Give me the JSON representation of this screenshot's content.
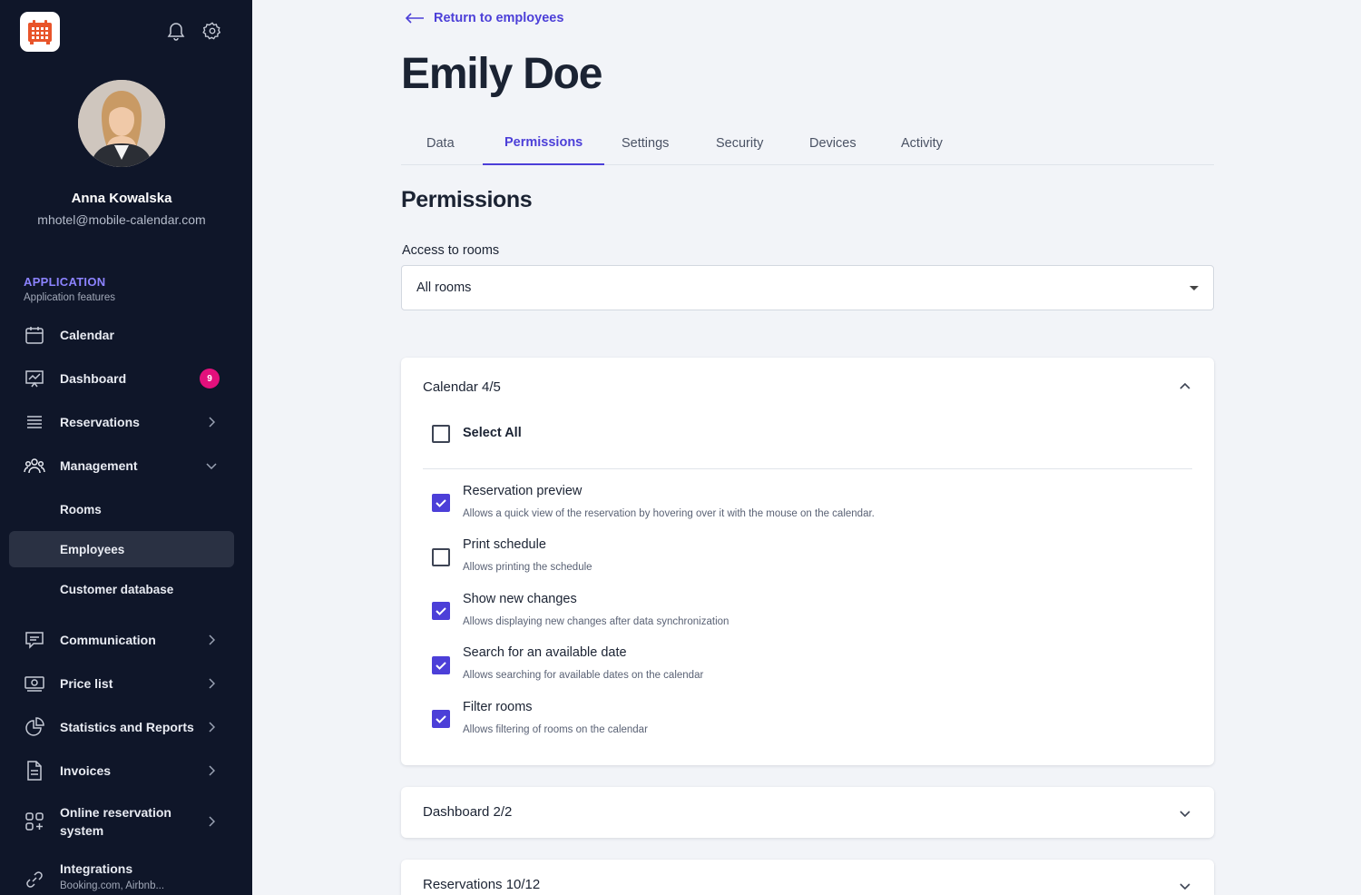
{
  "sidebar": {
    "user": {
      "name": "Anna Kowalska",
      "email": "mhotel@mobile-calendar.com"
    },
    "section": {
      "title": "APPLICATION",
      "subtitle": "Application features"
    },
    "items": [
      {
        "label": "Calendar",
        "icon": "calendar-icon"
      },
      {
        "label": "Dashboard",
        "icon": "chart-presentation-icon",
        "badge": "9"
      },
      {
        "label": "Reservations",
        "icon": "list-icon"
      },
      {
        "label": "Management",
        "icon": "users-icon"
      },
      {
        "label": "Rooms"
      },
      {
        "label": "Employees"
      },
      {
        "label": "Customer database"
      },
      {
        "label": "Communication",
        "icon": "message-icon"
      },
      {
        "label": "Price list",
        "icon": "money-icon"
      },
      {
        "label": "Statistics and Reports",
        "icon": "pie-chart-icon"
      },
      {
        "label": "Invoices",
        "icon": "document-icon"
      },
      {
        "label": "Online reservation",
        "label2": "system",
        "icon": "apps-icon"
      },
      {
        "label": "Integrations",
        "sub": "Booking.com, Airbnb...",
        "icon": "link-icon"
      }
    ]
  },
  "main": {
    "back_link": "Return to employees",
    "title": "Emily Doe",
    "tabs": [
      "Data",
      "Permissions",
      "Settings",
      "Security",
      "Devices",
      "Activity"
    ],
    "active_tab": "Permissions",
    "section_heading": "Permissions",
    "access": {
      "label": "Access to rooms",
      "value": "All rooms"
    },
    "calendar_group": {
      "title": "Calendar 4/5",
      "select_all": "Select All",
      "permissions": [
        {
          "title": "Reservation preview",
          "desc": "Allows a quick view of the reservation by hovering over it with the mouse on the calendar.",
          "checked": true
        },
        {
          "title": "Print schedule",
          "desc": "Allows printing the schedule",
          "checked": false
        },
        {
          "title": "Show new changes",
          "desc": "Allows displaying new changes after data synchronization",
          "checked": true
        },
        {
          "title": "Search for an available date",
          "desc": "Allows searching for available dates on the calendar",
          "checked": true
        },
        {
          "title": "Filter rooms",
          "desc": "Allows filtering of rooms on the calendar",
          "checked": true
        }
      ]
    },
    "dashboard_group": {
      "title": "Dashboard 2/2"
    },
    "reservations_group": {
      "title": "Reservations 10/12"
    }
  },
  "colors": {
    "sidebar": "#0f1629",
    "accent": "#4c3fd8",
    "badge": "#e3107c",
    "logo": "#e8542a"
  }
}
